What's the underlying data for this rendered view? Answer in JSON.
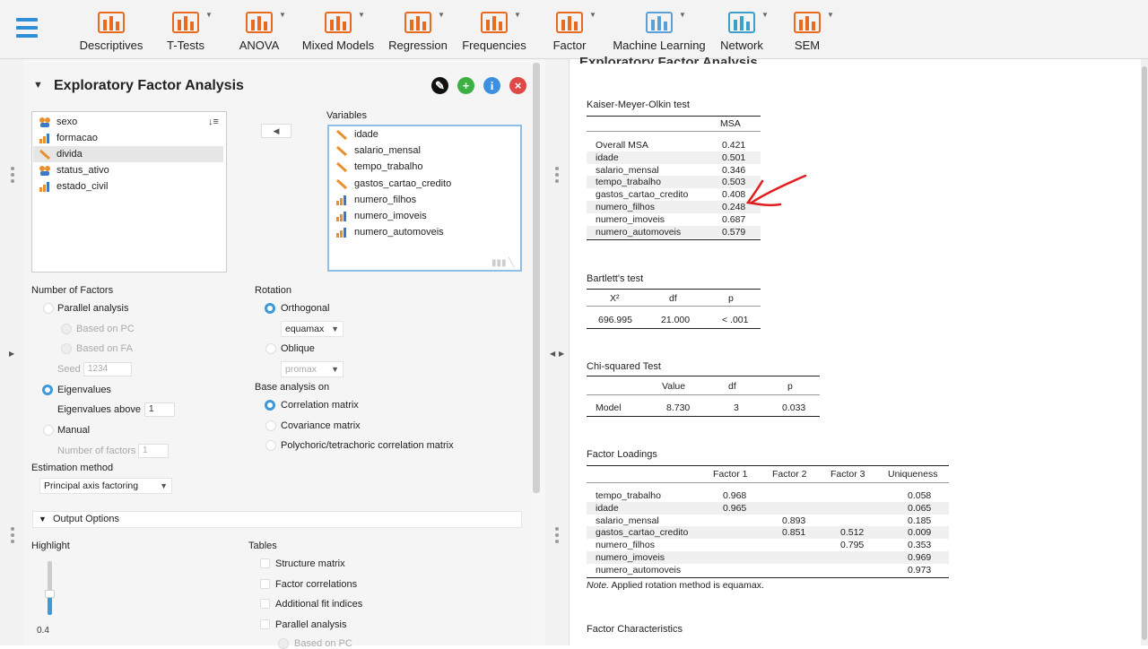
{
  "toolbar": {
    "items": [
      {
        "label": "Descriptives",
        "icon": "descriptives-icon"
      },
      {
        "label": "T-Tests",
        "icon": "t-tests-icon"
      },
      {
        "label": "ANOVA",
        "icon": "anova-icon"
      },
      {
        "label": "Mixed Models",
        "icon": "mixed-models-icon"
      },
      {
        "label": "Regression",
        "icon": "regression-icon"
      },
      {
        "label": "Frequencies",
        "icon": "frequencies-icon"
      },
      {
        "label": "Factor",
        "icon": "factor-icon"
      },
      {
        "label": "Machine Learning",
        "icon": "machine-learning-icon"
      },
      {
        "label": "Network",
        "icon": "network-icon"
      },
      {
        "label": "SEM",
        "icon": "sem-icon"
      }
    ]
  },
  "analysis": {
    "title": "Exploratory Factor Analysis",
    "source_vars": [
      {
        "name": "sexo",
        "type": "nominal"
      },
      {
        "name": "formacao",
        "type": "ordinal"
      },
      {
        "name": "divida",
        "type": "scale"
      },
      {
        "name": "status_ativo",
        "type": "nominal"
      },
      {
        "name": "estado_civil",
        "type": "ordinal"
      }
    ],
    "variables_label": "Variables",
    "variables": [
      {
        "name": "idade",
        "type": "scale"
      },
      {
        "name": "salario_mensal",
        "type": "scale"
      },
      {
        "name": "tempo_trabalho",
        "type": "scale"
      },
      {
        "name": "gastos_cartao_credito",
        "type": "scale"
      },
      {
        "name": "numero_filhos",
        "type": "ordinal"
      },
      {
        "name": "numero_imoveis",
        "type": "ordinal"
      },
      {
        "name": "numero_automoveis",
        "type": "ordinal"
      }
    ],
    "num_factors": {
      "label": "Number of Factors",
      "parallel": "Parallel analysis",
      "based_pc": "Based on PC",
      "based_fa": "Based on FA",
      "seed_label": "Seed",
      "seed_value": "1234",
      "eigen": "Eigenvalues",
      "eigen_above_label": "Eigenvalues above",
      "eigen_above_value": "1",
      "manual": "Manual",
      "num_factors_label": "Number of factors",
      "num_factors_value": "1"
    },
    "rotation": {
      "label": "Rotation",
      "orthogonal": "Orthogonal",
      "orthogonal_value": "equamax",
      "oblique": "Oblique",
      "oblique_value": "promax"
    },
    "base": {
      "label": "Base analysis on",
      "correlation": "Correlation matrix",
      "covariance": "Covariance matrix",
      "polychoric": "Polychoric/tetrachoric correlation matrix"
    },
    "estimation": {
      "label": "Estimation method",
      "value": "Principal axis factoring"
    },
    "output": {
      "title": "Output Options",
      "highlight_label": "Highlight",
      "highlight_value": "0.4",
      "highlight_level": 0.4,
      "tables_label": "Tables",
      "structure": "Structure matrix",
      "factor_corr": "Factor correlations",
      "fit_indices": "Additional fit indices",
      "parallel": "Parallel analysis",
      "based_pc": "Based on PC"
    }
  },
  "results": {
    "header": "Exploratory Factor Analysis",
    "kmo": {
      "title": "Kaiser-Meyer-Olkin test",
      "col": "MSA",
      "rows": [
        [
          "Overall MSA",
          "0.421"
        ],
        [
          "idade",
          "0.501"
        ],
        [
          "salario_mensal",
          "0.346"
        ],
        [
          "tempo_trabalho",
          "0.503"
        ],
        [
          "gastos_cartao_credito",
          "0.408"
        ],
        [
          "numero_filhos",
          "0.248"
        ],
        [
          "numero_imoveis",
          "0.687"
        ],
        [
          "numero_automoveis",
          "0.579"
        ]
      ]
    },
    "bartlett": {
      "title": "Bartlett's test",
      "cols": [
        "X²",
        "df",
        "p"
      ],
      "row": [
        "696.995",
        "21.000",
        "< .001"
      ]
    },
    "chisq": {
      "title": "Chi-squared Test",
      "cols": [
        "Value",
        "df",
        "p"
      ],
      "row": [
        "Model",
        "8.730",
        "3",
        "0.033"
      ]
    },
    "loadings": {
      "title": "Factor Loadings",
      "cols": [
        "Factor 1",
        "Factor 2",
        "Factor 3",
        "Uniqueness"
      ],
      "rows": [
        [
          "tempo_trabalho",
          "0.968",
          "",
          "",
          "0.058"
        ],
        [
          "idade",
          "0.965",
          "",
          "",
          "0.065"
        ],
        [
          "salario_mensal",
          "",
          "0.893",
          "",
          "0.185"
        ],
        [
          "gastos_cartao_credito",
          "",
          "0.851",
          "0.512",
          "0.009"
        ],
        [
          "numero_filhos",
          "",
          "",
          "0.795",
          "0.353"
        ],
        [
          "numero_imoveis",
          "",
          "",
          "",
          "0.969"
        ],
        [
          "numero_automoveis",
          "",
          "",
          "",
          "0.973"
        ]
      ],
      "note_label": "Note.",
      "note_text": " Applied rotation method is equamax."
    },
    "characteristics": {
      "title": "Factor Characteristics"
    }
  }
}
